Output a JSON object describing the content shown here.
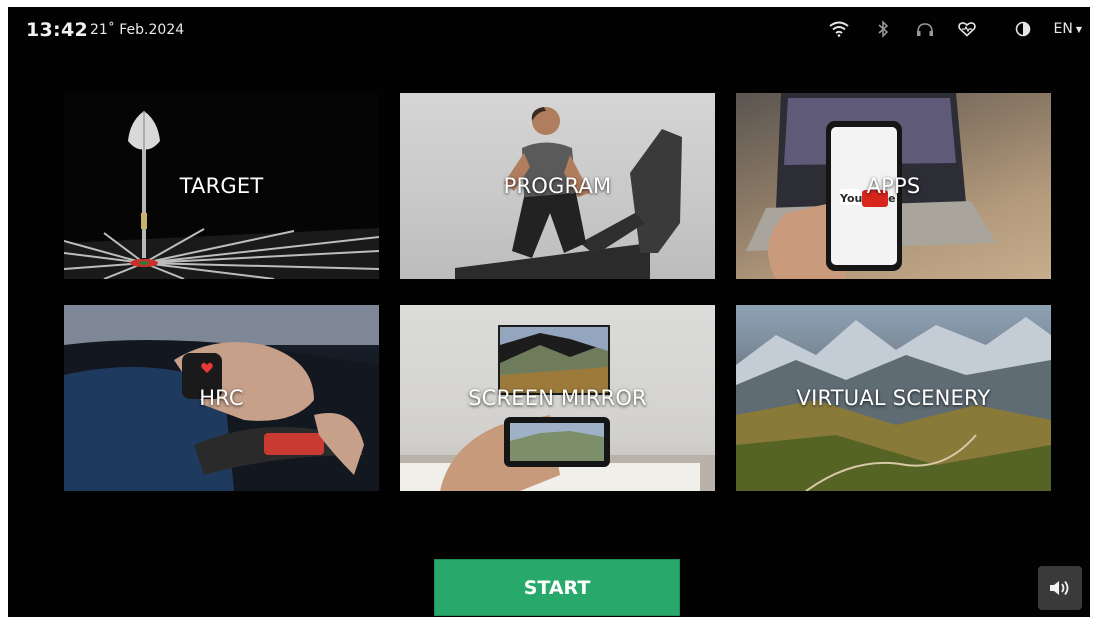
{
  "status": {
    "time": "13:42",
    "date": "21˚ Feb.2024",
    "language": "EN",
    "icons": [
      "wifi-icon",
      "bluetooth-icon",
      "headphones-icon",
      "heart-rate-icon",
      "contrast-icon"
    ]
  },
  "tiles": [
    {
      "id": "target",
      "label": "TARGET"
    },
    {
      "id": "program",
      "label": "PROGRAM"
    },
    {
      "id": "apps",
      "label": "APPS",
      "logo_text": "You Tube"
    },
    {
      "id": "hrc",
      "label": "HRC"
    },
    {
      "id": "screen-mirror",
      "label": "SCREEN MIRROR"
    },
    {
      "id": "virtual-scenery",
      "label": "VIRTUAL SCENERY"
    }
  ],
  "start_button": {
    "label": "START"
  },
  "volume": {
    "icon": "speaker-icon"
  },
  "colors": {
    "background": "#020202",
    "start_green": "#28a86b",
    "volume_button": "#3a3a3a",
    "text": "#ffffff"
  }
}
